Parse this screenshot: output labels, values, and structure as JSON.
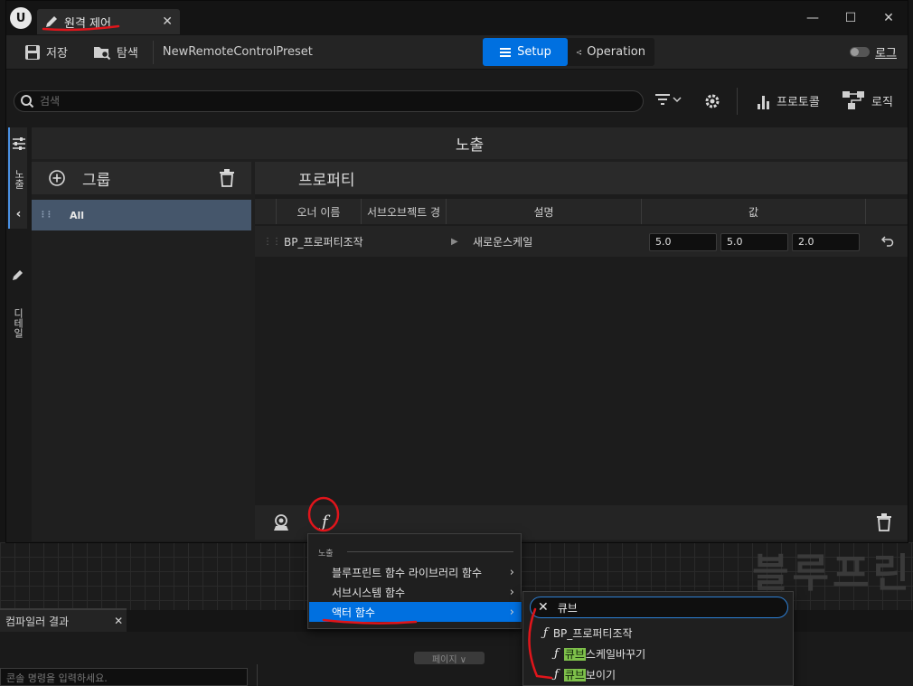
{
  "window": {
    "tab_title": "원격 제어",
    "preset_name": "NewRemoteControlPreset"
  },
  "toolbar": {
    "save_label": "저장",
    "browse_label": "탐색",
    "setup_label": "Setup",
    "operation_label": "Operation",
    "log_label": "로그"
  },
  "searchbar": {
    "placeholder": "검색",
    "protocol_label": "프로토콜",
    "logic_label": "로직"
  },
  "sidebar": {
    "exposed_label": "노출",
    "details_label": "디테일"
  },
  "panel": {
    "section_title": "노출",
    "groups_title": "그룹",
    "group_all": "All",
    "properties_title": "프로퍼티",
    "columns": [
      "오너 이름",
      "서브오브젝트 경",
      "설명",
      "값"
    ],
    "rows": [
      {
        "owner": "BP_프로퍼티조작",
        "description": "새로운스케일",
        "values": [
          "5.0",
          "5.0",
          "2.0"
        ]
      }
    ]
  },
  "context_menu": {
    "section": "노출",
    "items": [
      "블루프린트 함수 라이브러리 함수",
      "서브시스템 함수",
      "액터 함수"
    ],
    "selected_index": 2
  },
  "sub_menu": {
    "search_text": "큐브",
    "category": "BP_프로퍼티조작",
    "results": [
      {
        "highlight": "큐브",
        "rest": "스케일바꾸기"
      },
      {
        "highlight": "큐브",
        "rest": "보이기"
      }
    ]
  },
  "background": {
    "compiler_tab": "컴파일러 결과",
    "console_placeholder": "콘솔 명령을 입력하세요.",
    "page_button": "페이지 ∨",
    "watermark": "블루프린"
  },
  "colors": {
    "accent": "#0070e0",
    "annotation": "#e0151b",
    "highlight": "#7ec04a"
  }
}
